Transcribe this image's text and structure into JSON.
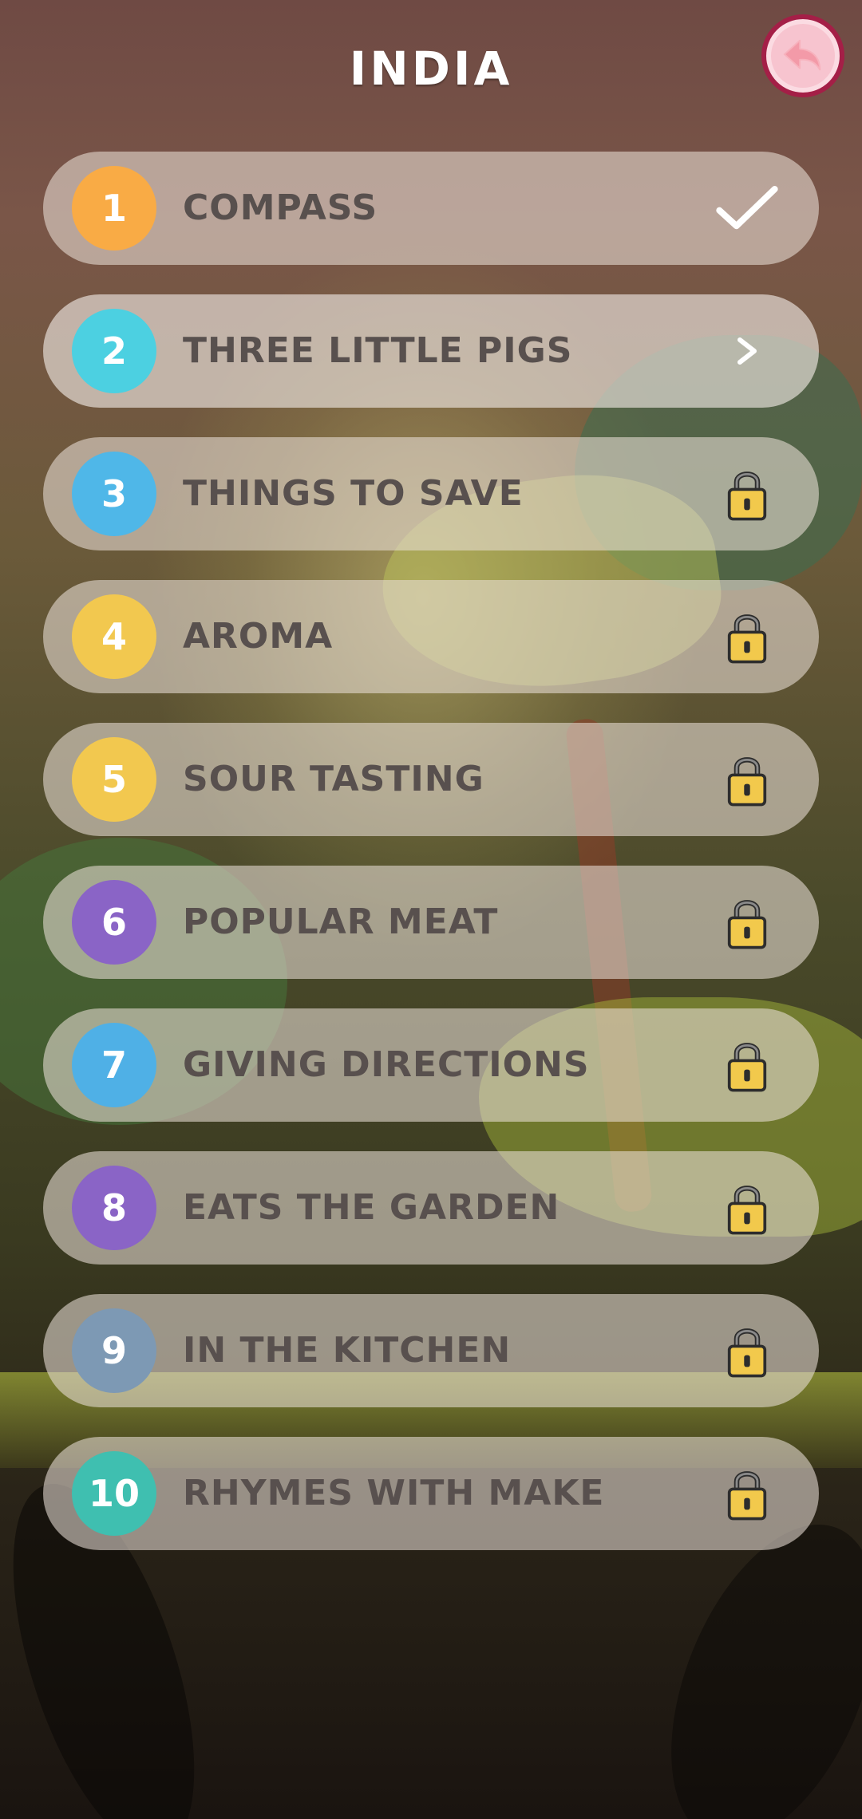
{
  "header": {
    "title": "INDIA",
    "back_icon": "back-arrow-icon"
  },
  "colors": {
    "back_button_fill": "#f7c4cf",
    "back_button_border": "#a41f47",
    "row_text": "#58504e",
    "lock_body": "#f2c94c"
  },
  "levels": [
    {
      "number": "1",
      "label": "COMPASS",
      "status": "completed",
      "status_icon": "check-icon",
      "badge_color": "#f9ab45"
    },
    {
      "number": "2",
      "label": "THREE LITTLE PIGS",
      "status": "current",
      "status_icon": "chevron-right-icon",
      "badge_color": "#4cd0e1"
    },
    {
      "number": "3",
      "label": "THINGS TO SAVE",
      "status": "locked",
      "status_icon": "lock-icon",
      "badge_color": "#4fb7e8"
    },
    {
      "number": "4",
      "label": "AROMA",
      "status": "locked",
      "status_icon": "lock-icon",
      "badge_color": "#f2c84f"
    },
    {
      "number": "5",
      "label": "SOUR TASTING",
      "status": "locked",
      "status_icon": "lock-icon",
      "badge_color": "#f2c84f"
    },
    {
      "number": "6",
      "label": "POPULAR MEAT",
      "status": "locked",
      "status_icon": "lock-icon",
      "badge_color": "#8a64c6"
    },
    {
      "number": "7",
      "label": "GIVING DIRECTIONS",
      "status": "locked",
      "status_icon": "lock-icon",
      "badge_color": "#4fb0e6"
    },
    {
      "number": "8",
      "label": "EATS THE GARDEN",
      "status": "locked",
      "status_icon": "lock-icon",
      "badge_color": "#8a64c6"
    },
    {
      "number": "9",
      "label": "IN THE KITCHEN",
      "status": "locked",
      "status_icon": "lock-icon",
      "badge_color": "#7d99b4"
    },
    {
      "number": "10",
      "label": "RHYMES WITH MAKE",
      "status": "locked",
      "status_icon": "lock-icon",
      "badge_color": "#3fbfb0"
    }
  ]
}
